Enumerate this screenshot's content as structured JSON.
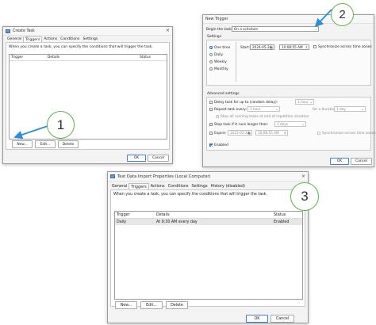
{
  "colors": {
    "badge_border": "#62b346",
    "arrow": "#2a8fd8",
    "accent": "#2b6cc4"
  },
  "badges": [
    "1",
    "2",
    "3"
  ],
  "create_task": {
    "title": "Create Task",
    "tabs": [
      "General",
      "Triggers",
      "Actions",
      "Conditions",
      "Settings"
    ],
    "description": "When you create a task, you can specify the conditions that will trigger the task.",
    "columns": [
      "Trigger",
      "Details",
      "Status"
    ],
    "buttons": {
      "new": "New...",
      "edit": "Edit...",
      "delete": "Delete",
      "ok": "OK",
      "cancel": "Cancel"
    }
  },
  "new_trigger": {
    "title": "New Trigger",
    "begin_label": "Begin the task:",
    "begin_value": "On a schedule",
    "settings_label": "Settings",
    "schedule_options": [
      "One time",
      "Daily",
      "Weekly",
      "Monthly"
    ],
    "start_label": "Start:",
    "start_date": "2024-05-24",
    "start_time": "10:08:55 AM",
    "sync_label": "Synchronize across time zones",
    "advanced_label": "Advanced settings",
    "delay_label": "Delay task for up to (random delay):",
    "delay_value": "1 hour",
    "repeat_label": "Repeat task every:",
    "repeat_value": "1 hour",
    "duration_label": "for a duration of:",
    "duration_value": "1 day",
    "stop_running_label": "Stop all running tasks at end of repetition duration",
    "stop_longer_label": "Stop task if it runs longer than:",
    "stop_longer_value": "3 days",
    "expire_label": "Expire:",
    "expire_date": "2025-05-24",
    "expire_time": "10:08:55 AM",
    "expire_sync_label": "Synchronize across time zones",
    "enabled_label": "Enabled",
    "buttons": {
      "ok": "OK",
      "cancel": "Cancel"
    }
  },
  "properties": {
    "title": "Test Data Import Properties (Local Computer)",
    "tabs": [
      "General",
      "Triggers",
      "Actions",
      "Conditions",
      "Settings",
      "History (disabled)"
    ],
    "description": "When you create a task, you can specify the conditions that will trigger the task.",
    "columns": [
      "Trigger",
      "Details",
      "Status"
    ],
    "rows": [
      {
        "trigger": "Daily",
        "details": "At 9:30 AM every day",
        "status": "Enabled"
      }
    ],
    "buttons": {
      "new": "New...",
      "edit": "Edit...",
      "delete": "Delete",
      "ok": "OK",
      "cancel": "Cancel"
    }
  }
}
